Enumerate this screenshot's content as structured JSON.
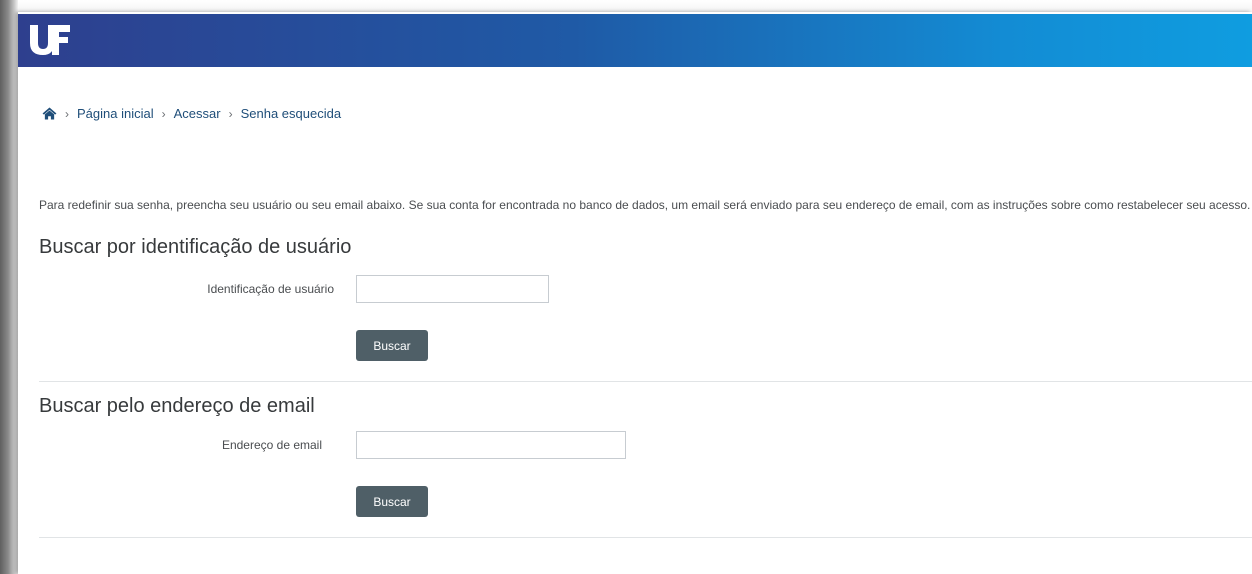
{
  "header": {
    "logo_text": "UF",
    "brand_colors": [
      "#2e3f8e",
      "#0f9de0"
    ]
  },
  "breadcrumb": {
    "home_icon": "home-icon",
    "items": [
      "Página inicial",
      "Acessar",
      "Senha esquecida"
    ],
    "separator": "›"
  },
  "intro_text": "Para redefinir sua senha, preencha seu usuário ou seu email abaixo. Se sua conta for encontrada no banco de dados, um email será enviado para seu endereço de email, com as instruções sobre como restabelecer seu acesso.",
  "username_section": {
    "heading": "Buscar por identificação de usuário",
    "field_label": "Identificação de usuário",
    "field_value": "",
    "button_label": "Buscar"
  },
  "email_section": {
    "heading": "Buscar pelo endereço de email",
    "field_label": "Endereço de email",
    "field_value": "",
    "button_label": "Buscar"
  },
  "colors": {
    "button_bg": "#4f5f67",
    "link": "#1f4e79"
  }
}
